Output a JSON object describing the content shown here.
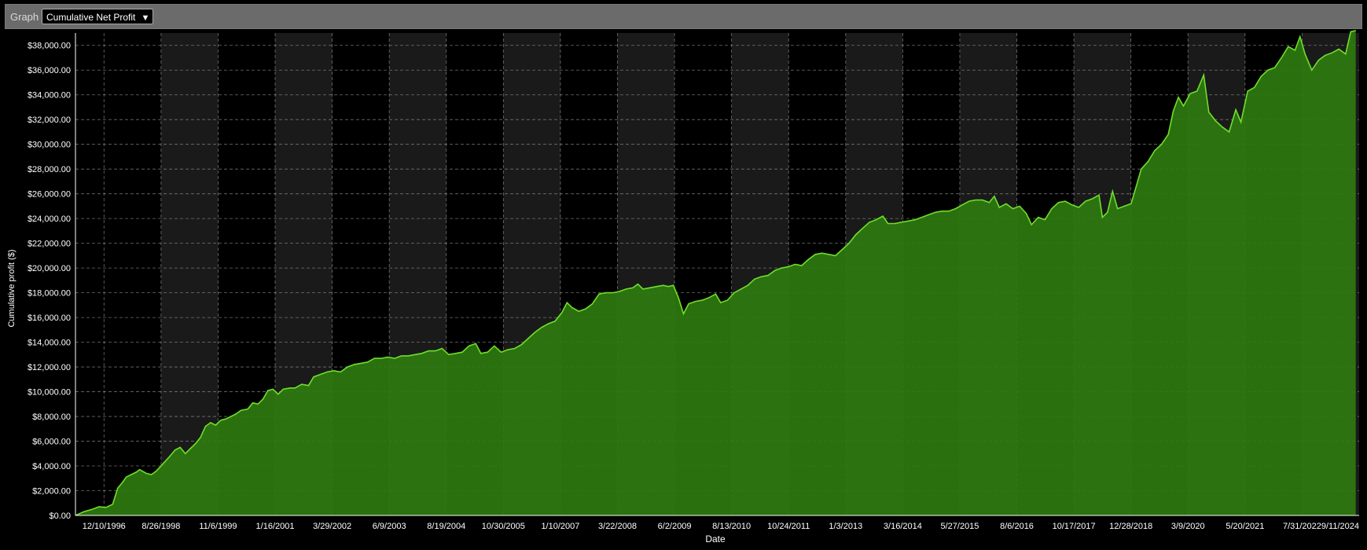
{
  "toolbar": {
    "label": "Graph",
    "graph_select_value": "Cumulative Net Profit"
  },
  "colors": {
    "fill": "#2f7a0f",
    "line": "#6ee02a",
    "band_dark": "#000000",
    "band_light": "#1a1a1a",
    "grid": "#9a9a9a"
  },
  "chart_data": {
    "type": "area",
    "title": "",
    "xlabel": "Date",
    "ylabel": "Cumulative profit ($)",
    "ylim": [
      0,
      39000
    ],
    "yticks": [
      "$0.00",
      "$2,000.00",
      "$4,000.00",
      "$6,000.00",
      "$8,000.00",
      "$10,000.00",
      "$12,000.00",
      "$14,000.00",
      "$16,000.00",
      "$18,000.00",
      "$20,000.00",
      "$22,000.00",
      "$24,000.00",
      "$26,000.00",
      "$28,000.00",
      "$30,000.00",
      "$32,000.00",
      "$34,000.00",
      "$36,000.00",
      "$38,000.00"
    ],
    "ytick_values": [
      0,
      2000,
      4000,
      6000,
      8000,
      10000,
      12000,
      14000,
      16000,
      18000,
      20000,
      22000,
      24000,
      26000,
      28000,
      30000,
      32000,
      34000,
      36000,
      38000
    ],
    "xticks": [
      "12/10/1996",
      "8/26/1998",
      "11/6/1999",
      "1/16/2001",
      "3/29/2002",
      "6/9/2003",
      "8/19/2004",
      "10/30/2005",
      "1/10/2007",
      "3/22/2008",
      "6/2/2009",
      "8/13/2010",
      "10/24/2011",
      "1/3/2013",
      "3/16/2014",
      "5/27/2015",
      "8/6/2016",
      "10/17/2017",
      "12/28/2018",
      "3/9/2020",
      "5/20/2021",
      "7/31/2022",
      "9/11/2024"
    ],
    "grid": true,
    "legend": "none",
    "series": [
      {
        "points": [
          [
            0,
            0
          ],
          [
            0.5,
            300
          ],
          [
            1,
            500
          ],
          [
            1.4,
            700
          ],
          [
            1.8,
            650
          ],
          [
            2.2,
            900
          ],
          [
            2.5,
            2200
          ],
          [
            2.8,
            2700
          ],
          [
            3,
            3100
          ],
          [
            3.3,
            3300
          ],
          [
            3.6,
            3500
          ],
          [
            3.8,
            3700
          ],
          [
            4.2,
            3400
          ],
          [
            4.5,
            3300
          ],
          [
            4.8,
            3600
          ],
          [
            5.2,
            4200
          ],
          [
            5.6,
            4800
          ],
          [
            5.9,
            5300
          ],
          [
            6.2,
            5500
          ],
          [
            6.5,
            5000
          ],
          [
            6.8,
            5400
          ],
          [
            7.1,
            5800
          ],
          [
            7.4,
            6300
          ],
          [
            7.7,
            7200
          ],
          [
            8,
            7500
          ],
          [
            8.3,
            7300
          ],
          [
            8.6,
            7700
          ],
          [
            8.9,
            7800
          ],
          [
            9.2,
            8000
          ],
          [
            9.5,
            8200
          ],
          [
            9.8,
            8500
          ],
          [
            10.2,
            8600
          ],
          [
            10.5,
            9100
          ],
          [
            10.8,
            9000
          ],
          [
            11.1,
            9400
          ],
          [
            11.4,
            10100
          ],
          [
            11.7,
            10200
          ],
          [
            12,
            9800
          ],
          [
            12.3,
            10200
          ],
          [
            12.7,
            10300
          ],
          [
            13,
            10300
          ],
          [
            13.4,
            10600
          ],
          [
            13.8,
            10500
          ],
          [
            14.1,
            11200
          ],
          [
            14.5,
            11400
          ],
          [
            14.9,
            11600
          ],
          [
            15.3,
            11700
          ],
          [
            15.7,
            11600
          ],
          [
            16.1,
            12000
          ],
          [
            16.5,
            12200
          ],
          [
            16.9,
            12300
          ],
          [
            17.3,
            12400
          ],
          [
            17.7,
            12700
          ],
          [
            18.1,
            12700
          ],
          [
            18.5,
            12800
          ],
          [
            18.9,
            12700
          ],
          [
            19.3,
            12900
          ],
          [
            19.7,
            12900
          ],
          [
            20.1,
            13000
          ],
          [
            20.5,
            13100
          ],
          [
            20.9,
            13300
          ],
          [
            21.3,
            13300
          ],
          [
            21.7,
            13500
          ],
          [
            22.1,
            13000
          ],
          [
            22.5,
            13100
          ],
          [
            22.9,
            13200
          ],
          [
            23.3,
            13700
          ],
          [
            23.7,
            13900
          ],
          [
            24,
            13100
          ],
          [
            24.4,
            13200
          ],
          [
            24.8,
            13700
          ],
          [
            25.2,
            13200
          ],
          [
            25.6,
            13400
          ],
          [
            26,
            13500
          ],
          [
            26.4,
            13800
          ],
          [
            26.8,
            14300
          ],
          [
            27.2,
            14800
          ],
          [
            27.6,
            15200
          ],
          [
            28,
            15500
          ],
          [
            28.4,
            15700
          ],
          [
            28.8,
            16400
          ],
          [
            29.1,
            17200
          ],
          [
            29.4,
            16800
          ],
          [
            29.8,
            16500
          ],
          [
            30.2,
            16700
          ],
          [
            30.6,
            17100
          ],
          [
            31,
            17900
          ],
          [
            31.4,
            18000
          ],
          [
            31.8,
            18000
          ],
          [
            32.2,
            18100
          ],
          [
            32.6,
            18300
          ],
          [
            33,
            18400
          ],
          [
            33.3,
            18700
          ],
          [
            33.6,
            18300
          ],
          [
            34,
            18400
          ],
          [
            34.4,
            18500
          ],
          [
            34.8,
            18600
          ],
          [
            35.1,
            18500
          ],
          [
            35.4,
            18600
          ],
          [
            35.7,
            17600
          ],
          [
            36,
            16300
          ],
          [
            36.3,
            17100
          ],
          [
            36.7,
            17300
          ],
          [
            37.1,
            17400
          ],
          [
            37.5,
            17600
          ],
          [
            37.9,
            17900
          ],
          [
            38.2,
            17200
          ],
          [
            38.6,
            17400
          ],
          [
            39,
            18000
          ],
          [
            39.4,
            18300
          ],
          [
            39.8,
            18600
          ],
          [
            40.2,
            19100
          ],
          [
            40.6,
            19300
          ],
          [
            41,
            19400
          ],
          [
            41.4,
            19800
          ],
          [
            41.8,
            20000
          ],
          [
            42.2,
            20100
          ],
          [
            42.6,
            20300
          ],
          [
            43,
            20200
          ],
          [
            43.4,
            20700
          ],
          [
            43.8,
            21100
          ],
          [
            44.2,
            21200
          ],
          [
            44.6,
            21100
          ],
          [
            45,
            21000
          ],
          [
            45.4,
            21500
          ],
          [
            45.8,
            22000
          ],
          [
            46.2,
            22700
          ],
          [
            46.6,
            23200
          ],
          [
            47,
            23700
          ],
          [
            47.4,
            23900
          ],
          [
            47.8,
            24200
          ],
          [
            48.1,
            23600
          ],
          [
            48.5,
            23600
          ],
          [
            48.9,
            23700
          ],
          [
            49.3,
            23800
          ],
          [
            49.7,
            23900
          ],
          [
            50.1,
            24100
          ],
          [
            50.5,
            24300
          ],
          [
            50.9,
            24500
          ],
          [
            51.3,
            24600
          ],
          [
            51.7,
            24600
          ],
          [
            52.1,
            24800
          ],
          [
            52.5,
            25100
          ],
          [
            52.9,
            25400
          ],
          [
            53.3,
            25500
          ],
          [
            53.7,
            25500
          ],
          [
            54.1,
            25300
          ],
          [
            54.4,
            25800
          ],
          [
            54.7,
            24900
          ],
          [
            55.1,
            25200
          ],
          [
            55.5,
            24800
          ],
          [
            55.9,
            25000
          ],
          [
            56.3,
            24400
          ],
          [
            56.6,
            23500
          ],
          [
            57,
            24100
          ],
          [
            57.4,
            23900
          ],
          [
            57.8,
            24800
          ],
          [
            58.2,
            25300
          ],
          [
            58.6,
            25400
          ],
          [
            59,
            25100
          ],
          [
            59.4,
            24900
          ],
          [
            59.8,
            25400
          ],
          [
            60.2,
            25600
          ],
          [
            60.6,
            25900
          ],
          [
            60.8,
            24100
          ],
          [
            61.1,
            24500
          ],
          [
            61.4,
            26200
          ],
          [
            61.7,
            24800
          ],
          [
            62.1,
            25000
          ],
          [
            62.5,
            25200
          ],
          [
            62.8,
            26600
          ],
          [
            63.1,
            28000
          ],
          [
            63.5,
            28600
          ],
          [
            63.9,
            29500
          ],
          [
            64.3,
            30000
          ],
          [
            64.7,
            30800
          ],
          [
            65,
            32700
          ],
          [
            65.3,
            33800
          ],
          [
            65.6,
            33100
          ],
          [
            66,
            34100
          ],
          [
            66.4,
            34300
          ],
          [
            66.8,
            35600
          ],
          [
            67.1,
            32600
          ],
          [
            67.5,
            31900
          ],
          [
            67.9,
            31400
          ],
          [
            68.3,
            31000
          ],
          [
            68.7,
            32800
          ],
          [
            69,
            31800
          ],
          [
            69.4,
            34300
          ],
          [
            69.8,
            34600
          ],
          [
            70.2,
            35500
          ],
          [
            70.6,
            36000
          ],
          [
            71,
            36200
          ],
          [
            71.4,
            37000
          ],
          [
            71.8,
            37900
          ],
          [
            72.2,
            37600
          ],
          [
            72.5,
            38700
          ],
          [
            72.8,
            37300
          ],
          [
            73.2,
            36000
          ],
          [
            73.6,
            36800
          ],
          [
            74,
            37200
          ],
          [
            74.4,
            37400
          ],
          [
            74.8,
            37700
          ],
          [
            75.2,
            37300
          ],
          [
            75.5,
            39100
          ],
          [
            75.8,
            39200
          ]
        ]
      }
    ]
  }
}
